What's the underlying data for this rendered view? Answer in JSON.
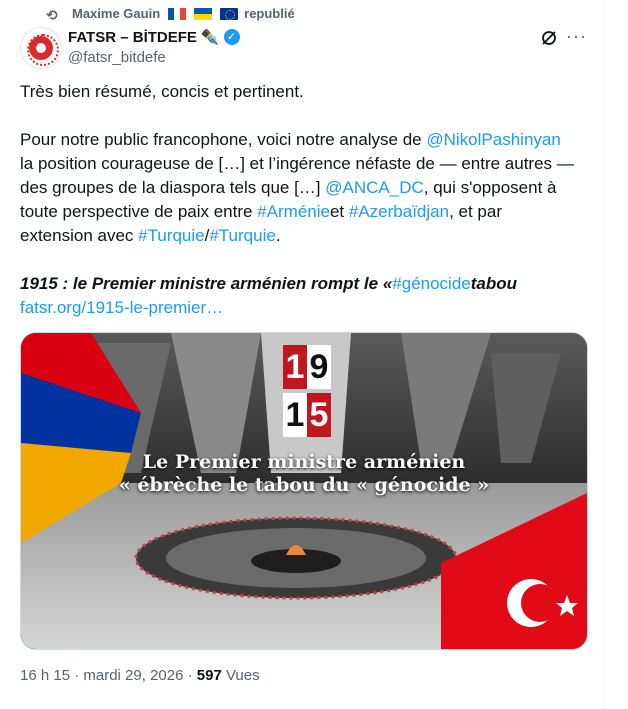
{
  "repost": {
    "author": "Maxime Gauin",
    "suffix": "republié"
  },
  "account": {
    "display_name": "FATSR – BİTDEFE",
    "pen": "✒️",
    "handle": "@fatsr_bitdefe"
  },
  "tweet": {
    "p1": "Très bien résumé, concis et pertinent.",
    "p2a": "Pour notre public francophone, voici notre analyse de ",
    "m1": "@NikolPashinyan",
    "p2b": "la position courageuse de […] et l’ingérence néfaste de — entre autres —",
    "p2c": "des groupes de la diaspora tels que […] ",
    "m2": "@ANCA_DC",
    "p2d": ", qui s'opposent à",
    "p2e": "toute perspective de paix entre ",
    "h1": "#Arménie",
    "p2f": "et ",
    "h2": "#Azerbaïdjan",
    "p2g": ", et par",
    "p2h": "extension avec ",
    "h3": "#Turquie",
    "slash": "/",
    "h4": "#Turquie",
    "dot": ".",
    "headline_a": "1915 : le Premier ministre arménien rompt le «",
    "headline_tag": "#génocide",
    "headline_b": "tabou",
    "url": "fatsr.org/1915-le-premier…"
  },
  "media": {
    "year_digits": [
      "1",
      "9",
      "1",
      "5"
    ],
    "line1": "Le Premier ministre arménien",
    "line2": "« ébrèche le tabou du « génocide »"
  },
  "meta": {
    "time": "16 h 15 · mardi 29, 2026 · ",
    "views_count": "597",
    "views_label": " Vues"
  },
  "colors": {
    "accent": "#1d9bf0",
    "muted": "#536471",
    "text": "#0f1419"
  },
  "icons": {
    "repost": "repost-icon",
    "verified": "verified-badge-icon",
    "grok": "grok-icon",
    "more": "more-icon"
  }
}
